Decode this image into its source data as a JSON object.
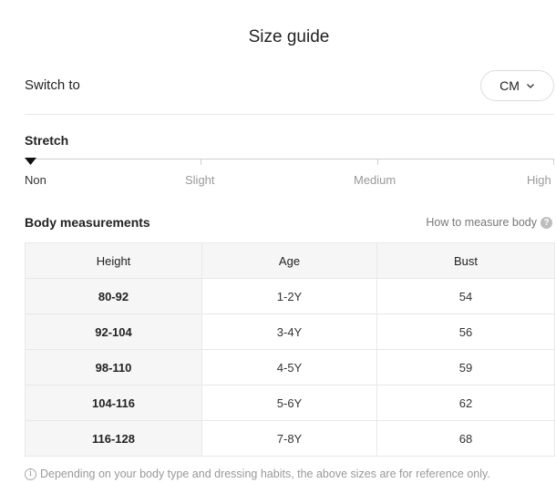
{
  "title": "Size guide",
  "switch": {
    "label": "Switch to",
    "unit": "CM",
    "icon": "chevron-down-icon"
  },
  "stretch": {
    "title": "Stretch",
    "levels": [
      "Non",
      "Slight",
      "Medium",
      "High"
    ],
    "selected": "Non"
  },
  "body_measurements": {
    "title": "Body measurements",
    "how_to_link": "How to measure body",
    "help_icon": "?",
    "columns": [
      "Height",
      "Age",
      "Bust"
    ],
    "rows": [
      [
        "80-92",
        "1-2Y",
        "54"
      ],
      [
        "92-104",
        "3-4Y",
        "56"
      ],
      [
        "98-110",
        "4-5Y",
        "59"
      ],
      [
        "104-116",
        "5-6Y",
        "62"
      ],
      [
        "116-128",
        "7-8Y",
        "68"
      ]
    ]
  },
  "footnote": {
    "icon": "i",
    "text": "Depending on your body type and dressing habits, the above sizes are for reference only."
  },
  "colors": {
    "text": "#222222",
    "muted": "#999999",
    "header_bg": "#f6f6f6",
    "border": "#e3e3e3"
  }
}
